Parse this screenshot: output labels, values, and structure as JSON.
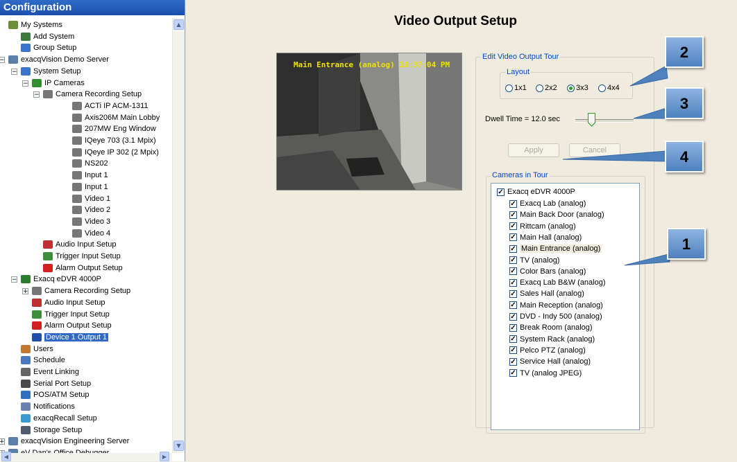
{
  "sidebar": {
    "title": "Configuration",
    "items": [
      {
        "label": "My Systems",
        "indent": 0,
        "icon": "network-icon",
        "exp": ""
      },
      {
        "label": "Add System",
        "indent": 1,
        "icon": "add-system-icon",
        "exp": ""
      },
      {
        "label": "Group Setup",
        "indent": 1,
        "icon": "group-setup-icon",
        "exp": ""
      },
      {
        "label": "exacqVision Demo Server",
        "indent": 0,
        "icon": "server-icon",
        "exp": "−"
      },
      {
        "label": "System Setup",
        "indent": 1,
        "icon": "system-setup-icon",
        "exp": "−"
      },
      {
        "label": "IP Cameras",
        "indent": 2,
        "icon": "ip-cameras-icon",
        "exp": "−"
      },
      {
        "label": "Camera Recording Setup",
        "indent": 3,
        "icon": "camera-icon",
        "exp": "−"
      },
      {
        "label": "ACTi IP ACM-1311",
        "indent": 4,
        "icon": "camera-icon",
        "exp": ""
      },
      {
        "label": "Axis206M Main Lobby",
        "indent": 4,
        "icon": "camera-icon",
        "exp": ""
      },
      {
        "label": "207MW Eng Window",
        "indent": 4,
        "icon": "camera-icon",
        "exp": ""
      },
      {
        "label": "IQeye 703 (3.1 Mpix)",
        "indent": 4,
        "icon": "camera-icon",
        "exp": ""
      },
      {
        "label": "IQeye IP 302 (2 Mpix)",
        "indent": 4,
        "icon": "camera-icon",
        "exp": ""
      },
      {
        "label": "NS202",
        "indent": 4,
        "icon": "camera-icon",
        "exp": ""
      },
      {
        "label": "Input 1",
        "indent": 4,
        "icon": "camera-icon",
        "exp": ""
      },
      {
        "label": "Input 1",
        "indent": 4,
        "icon": "camera-icon",
        "exp": ""
      },
      {
        "label": "Video 1",
        "indent": 4,
        "icon": "camera-icon",
        "exp": ""
      },
      {
        "label": "Video 2",
        "indent": 4,
        "icon": "camera-icon",
        "exp": ""
      },
      {
        "label": "Video 3",
        "indent": 4,
        "icon": "camera-icon",
        "exp": ""
      },
      {
        "label": "Video 4",
        "indent": 4,
        "icon": "camera-icon",
        "exp": ""
      },
      {
        "label": "Audio Input Setup",
        "indent": 3,
        "icon": "speaker-icon",
        "exp": ""
      },
      {
        "label": "Trigger Input Setup",
        "indent": 3,
        "icon": "trigger-icon",
        "exp": ""
      },
      {
        "label": "Alarm Output Setup",
        "indent": 3,
        "icon": "alarm-icon",
        "exp": ""
      },
      {
        "label": "Exacq eDVR 4000P",
        "indent": 1,
        "icon": "dvr-card-icon",
        "exp": "−"
      },
      {
        "label": "Camera Recording Setup",
        "indent": 2,
        "icon": "camera-icon",
        "exp": "+"
      },
      {
        "label": "Audio Input Setup",
        "indent": 2,
        "icon": "speaker-icon",
        "exp": ""
      },
      {
        "label": "Trigger Input Setup",
        "indent": 2,
        "icon": "trigger-icon",
        "exp": ""
      },
      {
        "label": "Alarm Output Setup",
        "indent": 2,
        "icon": "alarm-icon",
        "exp": ""
      },
      {
        "label": "Device 1 Output 1",
        "indent": 2,
        "icon": "video-output-icon",
        "exp": "",
        "selected": true
      },
      {
        "label": "Users",
        "indent": 1,
        "icon": "users-icon",
        "exp": ""
      },
      {
        "label": "Schedule",
        "indent": 1,
        "icon": "schedule-icon",
        "exp": ""
      },
      {
        "label": "Event Linking",
        "indent": 1,
        "icon": "link-icon",
        "exp": ""
      },
      {
        "label": "Serial Port Setup",
        "indent": 1,
        "icon": "serial-port-icon",
        "exp": ""
      },
      {
        "label": "POS/ATM Setup",
        "indent": 1,
        "icon": "pos-icon",
        "exp": ""
      },
      {
        "label": "Notifications",
        "indent": 1,
        "icon": "mail-icon",
        "exp": ""
      },
      {
        "label": "exacqRecall Setup",
        "indent": 1,
        "icon": "recall-icon",
        "exp": ""
      },
      {
        "label": "Storage Setup",
        "indent": 1,
        "icon": "storage-icon",
        "exp": ""
      },
      {
        "label": "exacqVision Engineering Server",
        "indent": 0,
        "icon": "server-icon",
        "exp": "+"
      },
      {
        "label": "eV Dan's Office Debugger",
        "indent": 0,
        "icon": "server-icon",
        "exp": "+"
      }
    ]
  },
  "main": {
    "title": "Video Output Setup",
    "video_overlay": "Main Entrance (analog) 10:37:04 PM",
    "tour_group": "Edit Video Output Tour",
    "layout_group": "Layout",
    "layout_options": [
      "1x1",
      "2x2",
      "3x3",
      "4x4"
    ],
    "layout_selected": "3x3",
    "dwell_label": "Dwell Time = 12.0 sec",
    "dwell_fraction": 0.27,
    "apply_label": "Apply",
    "cancel_label": "Cancel",
    "cameras_group": "Cameras in Tour",
    "camera_root": "Exacq eDVR 4000P",
    "cameras": [
      "Exacq Lab (analog)",
      "Main Back Door (analog)",
      "Rittcam (analog)",
      "Main Hall (analog)",
      "Main Entrance (analog)",
      "TV (analog)",
      "Color Bars (analog)",
      "Exacq Lab B&W (analog)",
      "Sales Hall (analog)",
      "Main Reception (analog)",
      "DVD - Indy 500 (analog)",
      "Break Room (analog)",
      "System Rack (analog)",
      "Pelco PTZ (analog)",
      "Service Hall (analog)",
      "TV (analog JPEG)"
    ],
    "highlighted_camera": "Main Entrance (analog)"
  },
  "callouts": [
    "2",
    "3",
    "4",
    "1"
  ],
  "colors": {
    "title_bar": "#2f6cc7",
    "selection": "#316ac5",
    "callout": "#4f81bd",
    "legend": "#0046d5"
  }
}
